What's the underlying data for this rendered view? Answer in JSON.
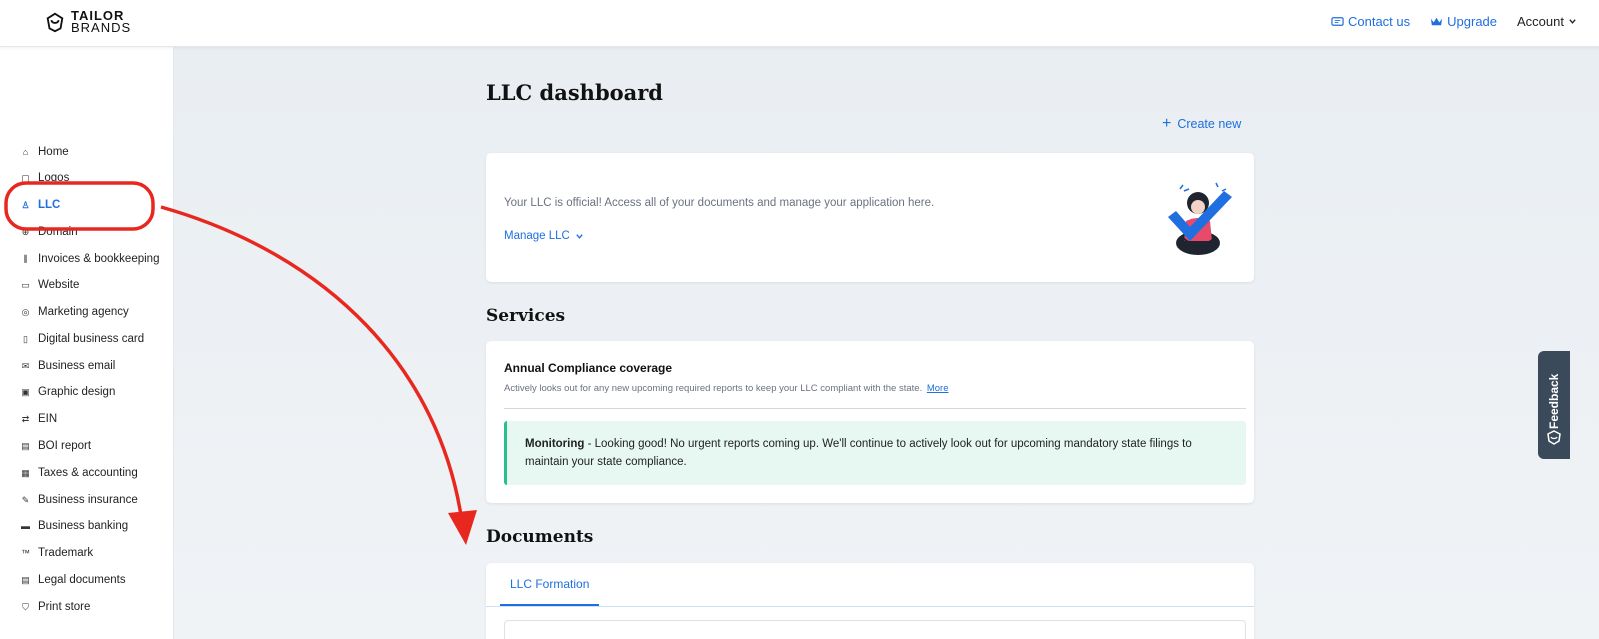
{
  "brand": {
    "line1": "TAILOR",
    "line2": "BRANDS"
  },
  "topnav": {
    "contact": "Contact us",
    "upgrade": "Upgrade",
    "account": "Account"
  },
  "sidebar": {
    "items": [
      {
        "label": "Home",
        "icon": "home-icon"
      },
      {
        "label": "Logos",
        "icon": "logo-icon"
      },
      {
        "label": "LLC",
        "icon": "llc-icon",
        "active": true
      },
      {
        "label": "Domain",
        "icon": "globe-icon"
      },
      {
        "label": "Invoices & bookkeeping",
        "icon": "chart-icon"
      },
      {
        "label": "Website",
        "icon": "monitor-icon"
      },
      {
        "label": "Marketing agency",
        "icon": "target-icon"
      },
      {
        "label": "Digital business card",
        "icon": "card-icon"
      },
      {
        "label": "Business email",
        "icon": "mail-icon"
      },
      {
        "label": "Graphic design",
        "icon": "image-icon"
      },
      {
        "label": "EIN",
        "icon": "ein-icon"
      },
      {
        "label": "BOI report",
        "icon": "report-icon"
      },
      {
        "label": "Taxes & accounting",
        "icon": "tax-icon"
      },
      {
        "label": "Business insurance",
        "icon": "edit-icon"
      },
      {
        "label": "Business banking",
        "icon": "bank-card-icon"
      },
      {
        "label": "Trademark",
        "icon": "trademark-icon"
      },
      {
        "label": "Legal documents",
        "icon": "document-icon"
      },
      {
        "label": "Print store",
        "icon": "shirt-icon"
      }
    ]
  },
  "main": {
    "title": "LLC dashboard",
    "create_new": "Create new",
    "status_card": {
      "message": "Your LLC is official! Access all of your documents and manage your application here.",
      "manage": "Manage LLC"
    },
    "services": {
      "heading": "Services",
      "title": "Annual Compliance coverage",
      "description": "Actively looks out for any new upcoming required reports to keep your LLC compliant with the state.",
      "more": "More",
      "monitor_label": "Monitoring",
      "monitor_text": " - Looking good! No urgent reports coming up. We'll continue to actively look out for upcoming mandatory state filings to maintain your state compliance."
    },
    "documents": {
      "heading": "Documents",
      "tab": "LLC Formation"
    }
  },
  "feedback": {
    "label": "Feedback"
  },
  "colors": {
    "accent": "#1f6fe0",
    "annotation": "#e8281f",
    "success": "#27c08a"
  }
}
